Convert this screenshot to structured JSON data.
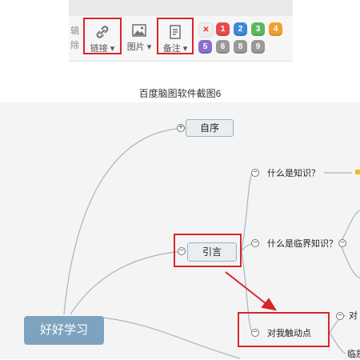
{
  "toolbar": {
    "side_label": "编辑删除",
    "side_text_top": "辑",
    "side_text_bottom": "除",
    "link_label": "链接 ▾",
    "image_label": "图片 ▾",
    "note_label": "备注 ▾",
    "priority_clear": "✕",
    "priorities_row1": [
      "1",
      "2",
      "3",
      "4"
    ],
    "priorities_row2": [
      "5",
      "6",
      "8",
      "9"
    ],
    "priority_colors_row1": [
      "#e74c4c",
      "#3f88d6",
      "#5cb85c",
      "#f0a030"
    ],
    "priority_colors_row2": [
      "#8a6fd0",
      "#999999",
      "#999999",
      "#999999"
    ]
  },
  "caption": "百度脑图软件截图6",
  "mindmap": {
    "root": "好好学习",
    "node_preface": "自序",
    "node_intro": "引言",
    "node_what_is_knowledge": "什么是知识？",
    "node_what_is_critical": "什么是临界知识？",
    "node_touching_point": "对我触动点",
    "node_partial_1": "对",
    "node_partial_2": "临质"
  },
  "colors": {
    "highlight": "#d7262b",
    "root_bg": "#7ea3bf",
    "connector": "#9fb8c4"
  }
}
